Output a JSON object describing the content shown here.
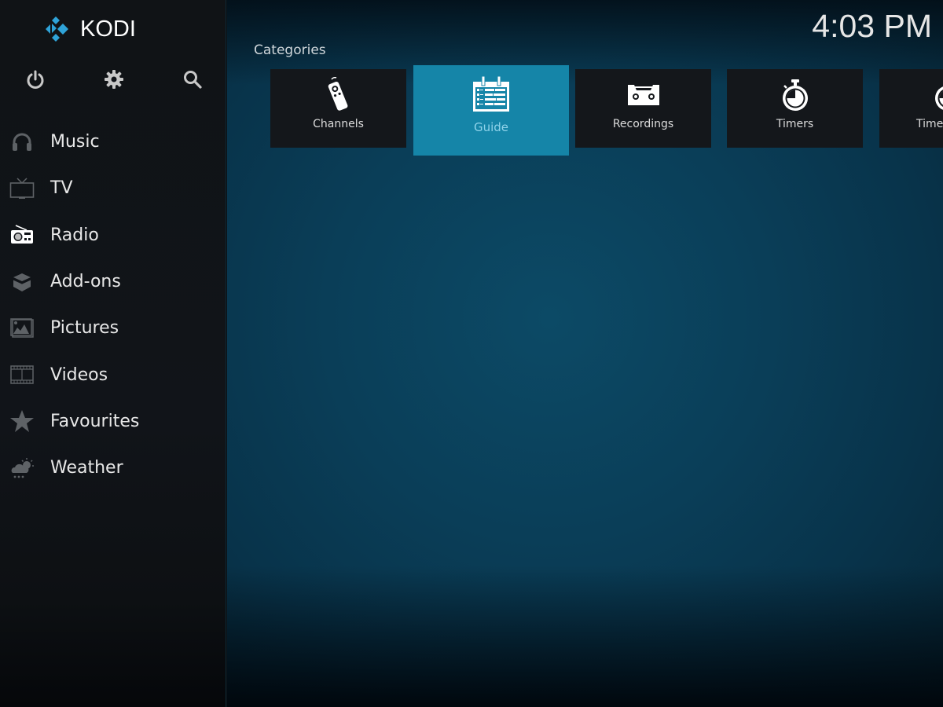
{
  "app": {
    "name": "KODI",
    "accent_color": "#1585a8",
    "logo_color": "#2fa3d8"
  },
  "clock": "4:03 PM",
  "top_buttons": [
    {
      "name": "power",
      "icon": "power-icon"
    },
    {
      "name": "settings",
      "icon": "gear-icon"
    },
    {
      "name": "search",
      "icon": "search-icon"
    }
  ],
  "sidebar": {
    "items": [
      {
        "label": "Music",
        "icon": "headphones-icon"
      },
      {
        "label": "TV",
        "icon": "tv-icon"
      },
      {
        "label": "Radio",
        "icon": "radio-icon"
      },
      {
        "label": "Add-ons",
        "icon": "box-icon"
      },
      {
        "label": "Pictures",
        "icon": "picture-icon"
      },
      {
        "label": "Videos",
        "icon": "film-icon"
      },
      {
        "label": "Favourites",
        "icon": "star-icon"
      },
      {
        "label": "Weather",
        "icon": "weather-icon"
      }
    ]
  },
  "main": {
    "section_title": "Categories",
    "focused_index": 1,
    "tiles": [
      {
        "label": "Channels",
        "icon": "remote-icon"
      },
      {
        "label": "Guide",
        "icon": "calendar-icon"
      },
      {
        "label": "Recordings",
        "icon": "cassette-icon"
      },
      {
        "label": "Timers",
        "icon": "stopwatch-icon"
      },
      {
        "label": "Timer rules",
        "icon": "stopwatch-icon"
      }
    ]
  }
}
